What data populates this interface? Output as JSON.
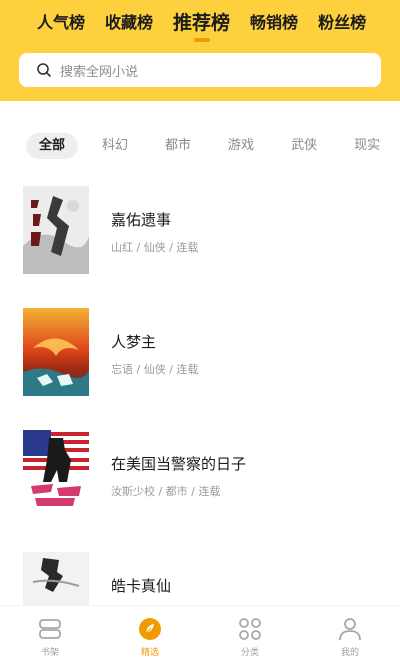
{
  "header": {
    "rank_tabs": [
      "人气榜",
      "收藏榜",
      "推荐榜",
      "畅销榜",
      "粉丝榜"
    ],
    "active_rank_tab": "推荐榜",
    "search_placeholder": "搜索全网小说",
    "accent_color": "#FDD03E"
  },
  "categories": [
    "全部",
    "科幻",
    "都市",
    "游戏",
    "武侠",
    "现实"
  ],
  "active_category": "全部",
  "books": [
    {
      "title": "嘉佑遗事",
      "meta": "山红 / 仙侠 / 连载",
      "cover_icon": "ink-painting-cover"
    },
    {
      "title": "人梦主",
      "meta": "忘语 / 仙侠 / 连载",
      "cover_icon": "red-sky-cover"
    },
    {
      "title": "在美国当警察的日子",
      "meta": "汝斯少校 / 都市 / 连载",
      "cover_icon": "us-flag-cover"
    },
    {
      "title": "皓卡真仙",
      "meta": "",
      "cover_icon": "calligraphy-cover"
    }
  ],
  "tabbar": {
    "items": [
      "书架",
      "精选",
      "分类",
      "我的"
    ],
    "active": "精选",
    "active_color": "#f39a00"
  }
}
